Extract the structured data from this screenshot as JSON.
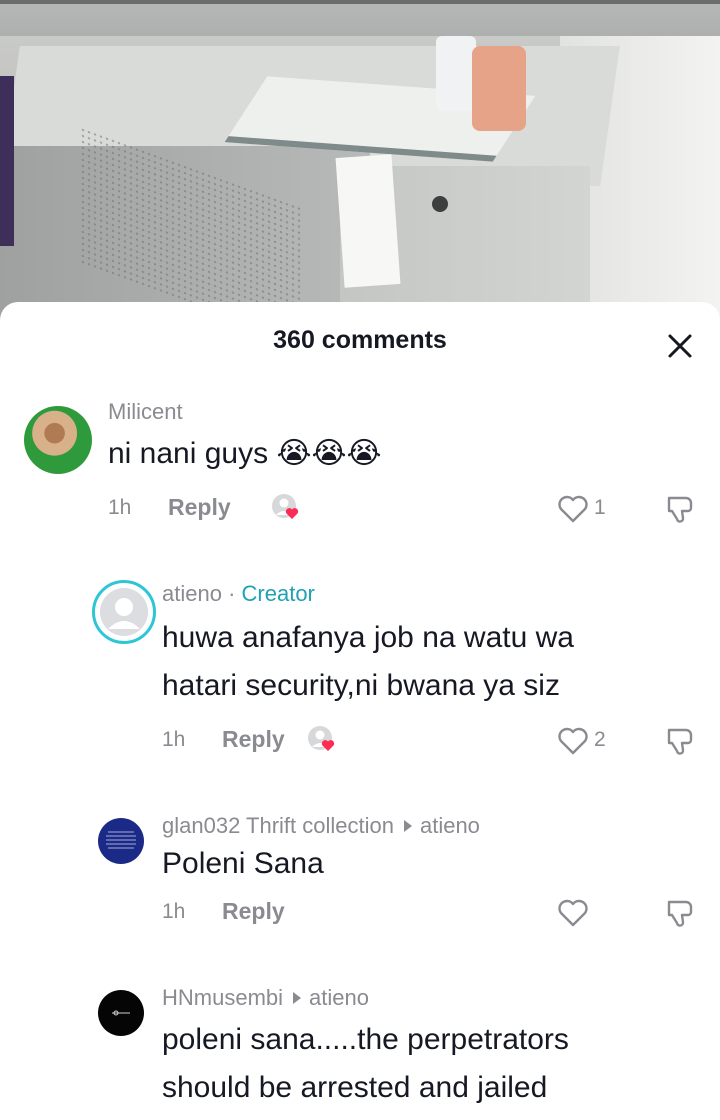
{
  "sheet": {
    "title": "360 comments"
  },
  "comments": [
    {
      "username": "Milicent",
      "text": "ni nani guys 😭😭😭",
      "time": "1h",
      "reply": "Reply",
      "likes": "1"
    },
    {
      "username": "atieno",
      "separator": " · ",
      "badge": "Creator",
      "text_line1": "huwa anafanya job na watu wa",
      "text_line2": "hatari security,ni bwana ya siz",
      "time": "1h",
      "reply": "Reply",
      "likes": "2"
    },
    {
      "username": "glan032 Thrift collection",
      "reply_to": "atieno",
      "text": "Poleni Sana",
      "time": "1h",
      "reply": "Reply"
    },
    {
      "username": "HNmusembi",
      "reply_to": "atieno",
      "text_line1": "poleni sana.....the perpetrators",
      "text_line2": "should be arrested and jailed"
    }
  ],
  "colors": {
    "accent_creator": "#1fa2b6",
    "heart": "#fe2c55",
    "text_primary": "#161823",
    "text_secondary": "#8a8b91"
  }
}
